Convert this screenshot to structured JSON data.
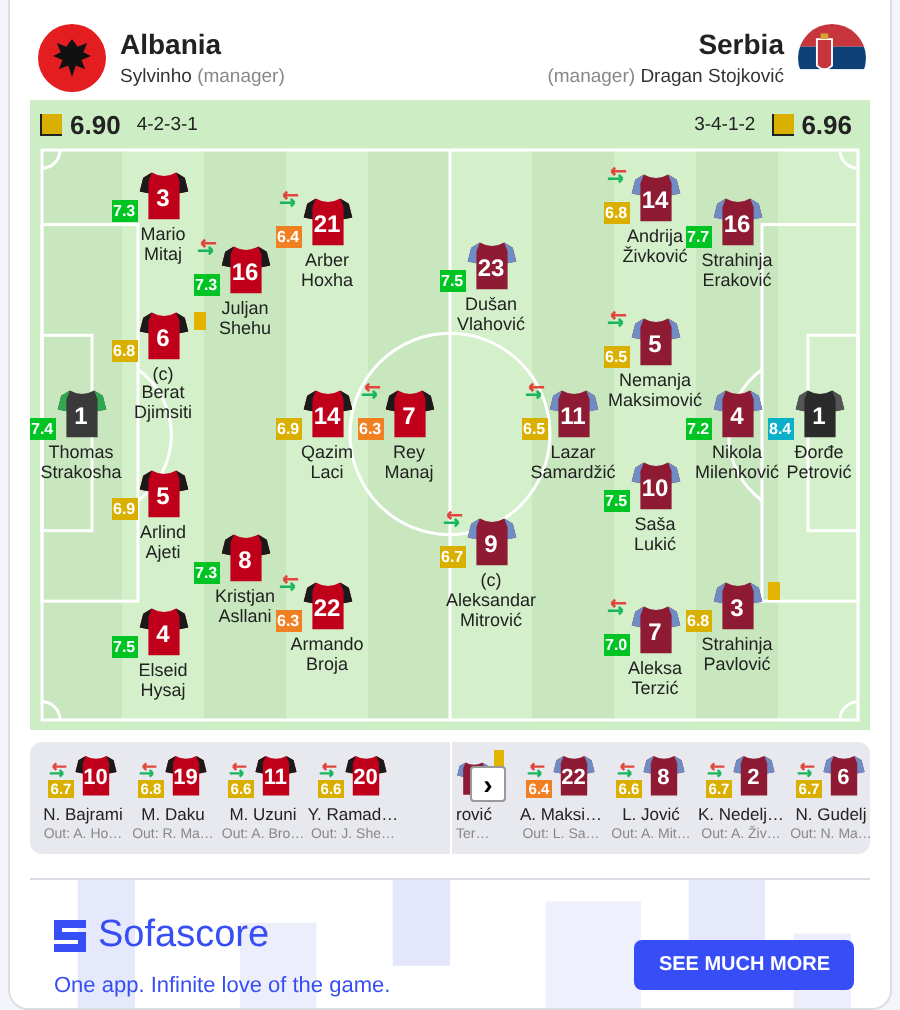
{
  "home": {
    "name": "Albania",
    "manager": "Sylvinho",
    "manager_label": "(manager)",
    "rating": "6.90",
    "formation": "4-2-3-1",
    "lines": [
      [
        {
          "kind": "goalkeeper",
          "number": "1",
          "name": "Thomas Strakosha",
          "rating": "7.4",
          "color": "#00c424",
          "sub": false,
          "card": false
        }
      ],
      [
        {
          "kind": "outfield",
          "number": "3",
          "name": "Mario Mitaj",
          "rating": "7.3",
          "color": "#00c424",
          "sub": false,
          "card": false
        },
        {
          "kind": "outfield",
          "number": "6",
          "name": "(c) Berat Djimsiti",
          "rating": "6.8",
          "color": "#d9af00",
          "sub": false,
          "card": true
        },
        {
          "kind": "outfield",
          "number": "5",
          "name": "Arlind Ajeti",
          "rating": "6.9",
          "color": "#d9af00",
          "sub": false,
          "card": false
        },
        {
          "kind": "outfield",
          "number": "4",
          "name": "Elseid Hysaj",
          "rating": "7.5",
          "color": "#00c424",
          "sub": false,
          "card": false
        }
      ],
      [
        {
          "kind": "outfield",
          "number": "16",
          "name": "Juljan Shehu",
          "rating": "7.3",
          "color": "#00c424",
          "sub": true,
          "card": false
        },
        {
          "kind": "outfield",
          "number": "8",
          "name": "Kristjan Asllani",
          "rating": "7.3",
          "color": "#00c424",
          "sub": false,
          "card": false
        }
      ],
      [
        {
          "kind": "outfield",
          "number": "21",
          "name": "Arber Hoxha",
          "rating": "6.4",
          "color": "#f08022",
          "sub": true,
          "card": false
        },
        {
          "kind": "outfield",
          "number": "14",
          "name": "Qazim Laci",
          "rating": "6.9",
          "color": "#d9af00",
          "sub": false,
          "card": false
        },
        {
          "kind": "outfield",
          "number": "22",
          "name": "Armando Broja",
          "rating": "6.3",
          "color": "#f08022",
          "sub": true,
          "card": false
        }
      ],
      [
        {
          "kind": "outfield",
          "number": "7",
          "name": "Rey Manaj",
          "rating": "6.3",
          "color": "#f08022",
          "sub": true,
          "card": false
        }
      ]
    ],
    "bench": [
      {
        "number": "10",
        "name": "N. Bajrami",
        "out": "Out: A. Ho…",
        "rating": "6.7",
        "color": "#d9af00",
        "sub": true,
        "card": false
      },
      {
        "number": "19",
        "name": "M. Daku",
        "out": "Out: R. Ma…",
        "rating": "6.8",
        "color": "#d9af00",
        "sub": true,
        "card": false
      },
      {
        "number": "11",
        "name": "M. Uzuni",
        "out": "Out: A. Bro…",
        "rating": "6.6",
        "color": "#d9af00",
        "sub": true,
        "card": false
      },
      {
        "number": "20",
        "name": "Y. Ramad…",
        "out": "Out: J. She…",
        "rating": "6.6",
        "color": "#d9af00",
        "sub": true,
        "card": false
      }
    ]
  },
  "away": {
    "name": "Serbia",
    "manager": "Dragan Stojković",
    "manager_label": "(manager)",
    "rating": "6.96",
    "formation": "3-4-1-2",
    "lines": [
      [
        {
          "kind": "goalkeeper",
          "number": "1",
          "name": "Đorđe Petrović",
          "rating": "8.4",
          "color": "#0ab0c8",
          "sub": false,
          "card": false
        }
      ],
      [
        {
          "kind": "outfield",
          "number": "16",
          "name": "Strahinja Eraković",
          "rating": "7.7",
          "color": "#00c424",
          "sub": false,
          "card": false
        },
        {
          "kind": "outfield",
          "number": "4",
          "name": "Nikola Milenković",
          "rating": "7.2",
          "color": "#00c424",
          "sub": false,
          "card": false
        },
        {
          "kind": "outfield",
          "number": "3",
          "name": "Strahinja Pavlović",
          "rating": "6.8",
          "color": "#d9af00",
          "sub": false,
          "card": true
        }
      ],
      [
        {
          "kind": "outfield",
          "number": "14",
          "name": "Andrija Živković",
          "rating": "6.8",
          "color": "#d9af00",
          "sub": true,
          "card": false
        },
        {
          "kind": "outfield",
          "number": "5",
          "name": "Nemanja Maksimović",
          "rating": "6.5",
          "color": "#d9af00",
          "sub": true,
          "card": false
        },
        {
          "kind": "outfield",
          "number": "10",
          "name": "Saša Lukić",
          "rating": "7.5",
          "color": "#00c424",
          "sub": false,
          "card": false
        },
        {
          "kind": "outfield",
          "number": "7",
          "name": "Aleksa Terzić",
          "rating": "7.0",
          "color": "#00c424",
          "sub": true,
          "card": false
        }
      ],
      [
        {
          "kind": "outfield",
          "number": "11",
          "name": "Lazar Samardžić",
          "rating": "6.5",
          "color": "#d9af00",
          "sub": true,
          "card": false
        }
      ],
      [
        {
          "kind": "outfield",
          "number": "23",
          "name": "Dušan Vlahović",
          "rating": "7.5",
          "color": "#00c424",
          "sub": false,
          "card": false
        },
        {
          "kind": "outfield",
          "number": "9",
          "name": "(c) Aleksandar Mitrović",
          "rating": "6.7",
          "color": "#d9af00",
          "sub": true,
          "card": false
        }
      ]
    ],
    "bench": [
      {
        "name": "rović",
        "out": "Ter…",
        "sub": false,
        "card": true
      },
      {
        "number": "22",
        "name": "A. Maksi…",
        "out": "Out: L. Sa…",
        "rating": "6.4",
        "color": "#f08022",
        "sub": true,
        "card": false
      },
      {
        "number": "8",
        "name": "L. Jović",
        "out": "Out: A. Mit…",
        "rating": "6.6",
        "color": "#d9af00",
        "sub": true,
        "card": false
      },
      {
        "number": "2",
        "name": "K. Nedelj…",
        "out": "Out: A. Živ…",
        "rating": "6.7",
        "color": "#d9af00",
        "sub": true,
        "card": false
      },
      {
        "number": "6",
        "name": "N. Gudelj",
        "out": "Out: N. Ma…",
        "rating": "6.7",
        "color": "#d9af00",
        "sub": true,
        "card": false
      }
    ]
  },
  "scroll_button": "›",
  "ad": {
    "logo": "Sofascore",
    "tagline": "One app. Infinite love of the game.",
    "button": "SEE MUCH MORE"
  }
}
